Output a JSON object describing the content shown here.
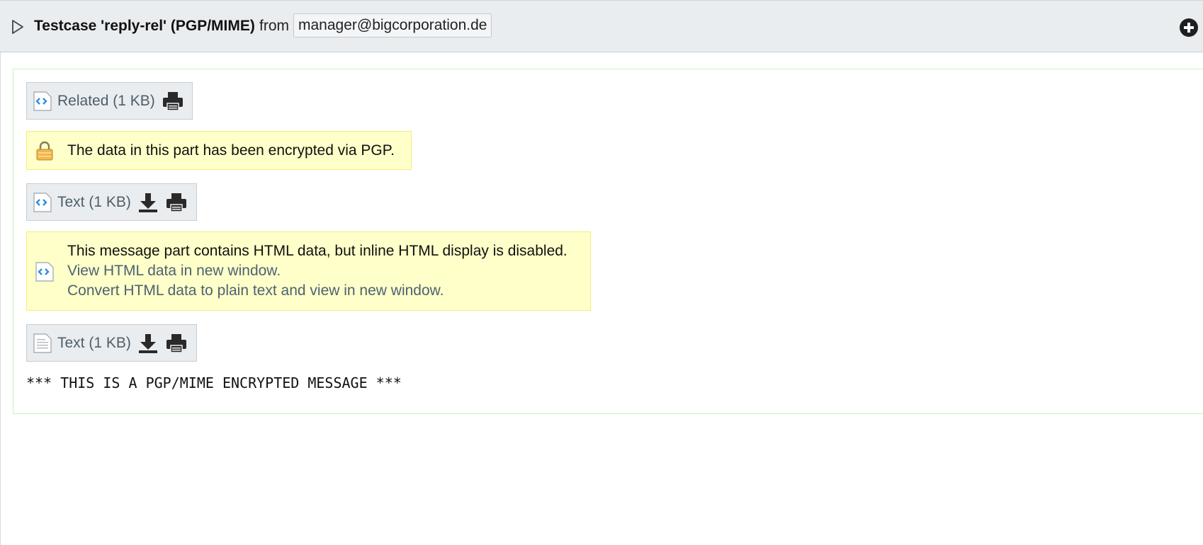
{
  "header": {
    "subject": "Testcase 'reply-rel' (PGP/MIME)",
    "from_label": "from",
    "from_address": "manager@bigcorporation.de"
  },
  "parts": [
    {
      "label": "Related (1 KB)",
      "icon": "html-file-icon",
      "tools": [
        "print-icon"
      ]
    },
    {
      "label": "Text (1 KB)",
      "icon": "html-file-icon",
      "tools": [
        "download-icon",
        "print-icon"
      ]
    },
    {
      "label": "Text (1 KB)",
      "icon": "text-file-icon",
      "tools": [
        "download-icon",
        "print-icon"
      ]
    }
  ],
  "notices": {
    "encrypted": "The data in this part has been encrypted via PGP.",
    "html_disabled": "This message part contains HTML data, but inline HTML display is disabled.",
    "view_html_link": "View HTML data in new window.",
    "convert_html_link": "Convert HTML data to plain text and view in new window."
  },
  "body_text": "*** THIS IS A PGP/MIME ENCRYPTED MESSAGE ***",
  "colors": {
    "header_bg": "#eaedef",
    "notice_bg": "#ffffc9",
    "link": "#4d6272",
    "content_border": "#c9f0c3"
  }
}
